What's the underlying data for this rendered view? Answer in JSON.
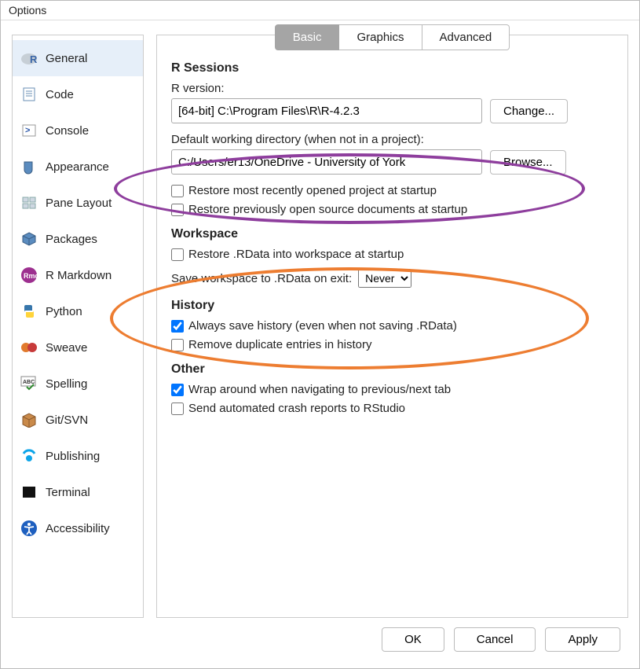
{
  "window": {
    "title": "Options"
  },
  "sidebar": {
    "items": [
      {
        "label": "General"
      },
      {
        "label": "Code"
      },
      {
        "label": "Console"
      },
      {
        "label": "Appearance"
      },
      {
        "label": "Pane Layout"
      },
      {
        "label": "Packages"
      },
      {
        "label": "R Markdown"
      },
      {
        "label": "Python"
      },
      {
        "label": "Sweave"
      },
      {
        "label": "Spelling"
      },
      {
        "label": "Git/SVN"
      },
      {
        "label": "Publishing"
      },
      {
        "label": "Terminal"
      },
      {
        "label": "Accessibility"
      }
    ]
  },
  "tabs": {
    "basic": "Basic",
    "graphics": "Graphics",
    "advanced": "Advanced"
  },
  "sessions": {
    "heading": "R Sessions",
    "rversion_label": "R version:",
    "rversion_value": "[64-bit] C:\\Program Files\\R\\R-4.2.3",
    "change_btn": "Change...",
    "defaultwd_label": "Default working directory (when not in a project):",
    "defaultwd_value": "C:/Users/er13/OneDrive - University of York",
    "browse_btn": "Browse...",
    "restore_project": "Restore most recently opened project at startup",
    "restore_docs": "Restore previously open source documents at startup"
  },
  "workspace": {
    "heading": "Workspace",
    "restore_rdata": "Restore .RData into workspace at startup",
    "save_label": "Save workspace to .RData on exit:",
    "save_value": "Never"
  },
  "history": {
    "heading": "History",
    "always_save": "Always save history (even when not saving .RData)",
    "remove_dup": "Remove duplicate entries in history"
  },
  "other": {
    "heading": "Other",
    "wrap": "Wrap around when navigating to previous/next tab",
    "crash": "Send automated crash reports to RStudio"
  },
  "footer": {
    "ok": "OK",
    "cancel": "Cancel",
    "apply": "Apply"
  }
}
